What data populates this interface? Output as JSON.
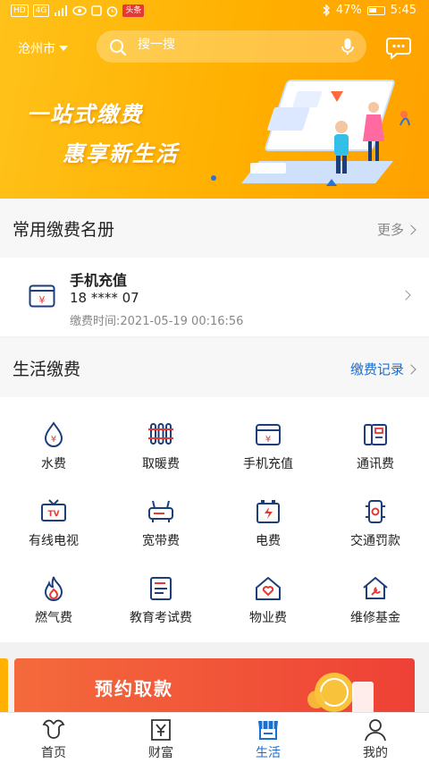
{
  "status_bar": {
    "left_chips": [
      "HD",
      "4G"
    ],
    "news_chip": "头条",
    "battery": "47%",
    "time": "5:45"
  },
  "header": {
    "city": "沧州市",
    "search_placeholder": "搜一搜"
  },
  "banner": {
    "line1": "一站式缴费",
    "line2": "惠享新生活"
  },
  "favorites": {
    "title": "常用缴费名册",
    "more": "更多",
    "item": {
      "name": "手机充值",
      "phone": "18 **** 07",
      "time": "缴费时间:2021-05-19 00:16:56"
    }
  },
  "life_pay": {
    "title": "生活缴费",
    "record_link": "缴费记录",
    "items": [
      {
        "label": "水费",
        "icon": "water-drop-icon"
      },
      {
        "label": "取暖费",
        "icon": "radiator-icon"
      },
      {
        "label": "手机充值",
        "icon": "phone-card-icon"
      },
      {
        "label": "通讯费",
        "icon": "telephone-icon"
      },
      {
        "label": "有线电视",
        "icon": "tv-icon"
      },
      {
        "label": "宽带费",
        "icon": "router-icon"
      },
      {
        "label": "电费",
        "icon": "battery-bolt-icon"
      },
      {
        "label": "交通罚款",
        "icon": "traffic-light-icon"
      },
      {
        "label": "燃气费",
        "icon": "flame-icon"
      },
      {
        "label": "教育考试费",
        "icon": "document-icon"
      },
      {
        "label": "物业费",
        "icon": "house-heart-icon"
      },
      {
        "label": "维修基金",
        "icon": "house-wrench-icon"
      }
    ]
  },
  "promo": {
    "title": "预约取款"
  },
  "tabs": [
    {
      "label": "首页",
      "icon": "home-bull-icon"
    },
    {
      "label": "财富",
      "icon": "wealth-icon"
    },
    {
      "label": "生活",
      "icon": "shop-icon"
    },
    {
      "label": "我的",
      "icon": "person-icon"
    }
  ],
  "colors": {
    "accent": "#1a6fd0",
    "brand_yellow": "#ffb000",
    "icon_red": "#e53935",
    "icon_navy": "#1c3e7a"
  }
}
